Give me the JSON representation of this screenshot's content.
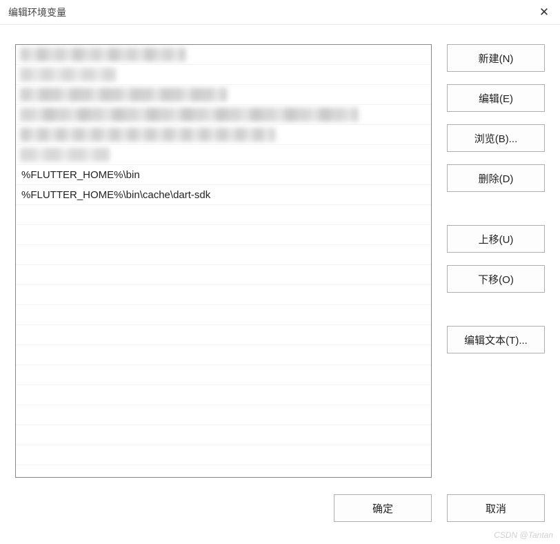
{
  "window": {
    "title": "编辑环境变量",
    "close_icon": "✕"
  },
  "list": {
    "items": [
      {
        "value": "",
        "blurred": true,
        "blurClass": "blur-1"
      },
      {
        "value": "",
        "blurred": true,
        "blurClass": "blur-2"
      },
      {
        "value": "",
        "blurred": true,
        "blurClass": "blur-3"
      },
      {
        "value": "",
        "blurred": true,
        "blurClass": "blur-4"
      },
      {
        "value": "",
        "blurred": true,
        "blurClass": "blur-5"
      },
      {
        "value": "",
        "blurred": true,
        "blurClass": "blur-6"
      },
      {
        "value": "%FLUTTER_HOME%\\bin",
        "blurred": false
      },
      {
        "value": "%FLUTTER_HOME%\\bin\\cache\\dart-sdk",
        "blurred": false
      }
    ]
  },
  "buttons": {
    "new": "新建(N)",
    "edit": "编辑(E)",
    "browse": "浏览(B)...",
    "delete": "删除(D)",
    "moveUp": "上移(U)",
    "moveDown": "下移(O)",
    "editText": "编辑文本(T)...",
    "ok": "确定",
    "cancel": "取消"
  },
  "watermark": "CSDN @Tantan"
}
